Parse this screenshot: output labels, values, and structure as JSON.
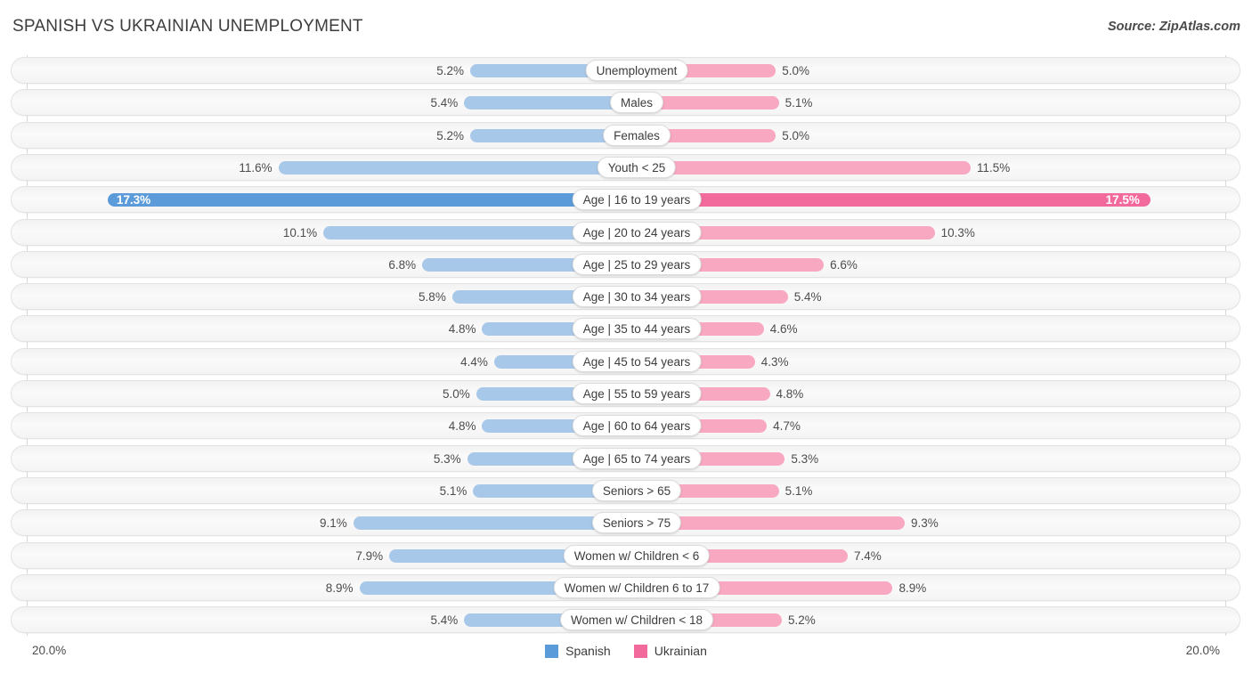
{
  "header": {
    "title": "SPANISH VS UKRAINIAN UNEMPLOYMENT",
    "source": "Source: ZipAtlas.com"
  },
  "legend": {
    "items": [
      {
        "label": "Spanish",
        "color": "#5b9bd9"
      },
      {
        "label": "Ukrainian",
        "color": "#f2699c"
      }
    ]
  },
  "axis": {
    "left_label": "20.0%",
    "right_label": "20.0%",
    "max": 20.0
  },
  "colors": {
    "left_bar": "#a8c8ea",
    "right_bar": "#f8a8c0",
    "left_bar_highlight": "#5b9bd9",
    "right_bar_highlight": "#f2699c",
    "track": "#f4f4f4",
    "text": "#3a3a3a"
  },
  "chart_data": {
    "type": "bar",
    "title": "SPANISH VS UKRAINIAN UNEMPLOYMENT",
    "subtitle": "",
    "xlabel": "",
    "ylabel": "",
    "orientation": "horizontal-diverging",
    "xlim": [
      0,
      20.0
    ],
    "grid": false,
    "legend_position": "bottom-center",
    "categories": [
      "Unemployment",
      "Males",
      "Females",
      "Youth < 25",
      "Age | 16 to 19 years",
      "Age | 20 to 24 years",
      "Age | 25 to 29 years",
      "Age | 30 to 34 years",
      "Age | 35 to 44 years",
      "Age | 45 to 54 years",
      "Age | 55 to 59 years",
      "Age | 60 to 64 years",
      "Age | 65 to 74 years",
      "Seniors > 65",
      "Seniors > 75",
      "Women w/ Children < 6",
      "Women w/ Children 6 to 17",
      "Women w/ Children < 18"
    ],
    "series": [
      {
        "name": "Spanish",
        "side": "left",
        "values": [
          5.2,
          5.4,
          5.2,
          11.6,
          17.3,
          10.1,
          6.8,
          5.8,
          4.8,
          4.4,
          5.0,
          4.8,
          5.3,
          5.1,
          9.1,
          7.9,
          8.9,
          5.4
        ],
        "labels": [
          "5.2%",
          "5.4%",
          "5.2%",
          "11.6%",
          "17.3%",
          "10.1%",
          "6.8%",
          "5.8%",
          "4.8%",
          "4.4%",
          "5.0%",
          "4.8%",
          "5.3%",
          "5.1%",
          "9.1%",
          "7.9%",
          "8.9%",
          "5.4%"
        ]
      },
      {
        "name": "Ukrainian",
        "side": "right",
        "values": [
          5.0,
          5.1,
          5.0,
          11.5,
          17.5,
          10.3,
          6.6,
          5.4,
          4.6,
          4.3,
          4.8,
          4.7,
          5.3,
          5.1,
          9.3,
          7.4,
          8.9,
          5.2
        ],
        "labels": [
          "5.0%",
          "5.1%",
          "5.0%",
          "11.5%",
          "17.5%",
          "10.3%",
          "6.6%",
          "5.4%",
          "4.6%",
          "4.3%",
          "4.8%",
          "4.7%",
          "5.3%",
          "5.1%",
          "9.3%",
          "7.4%",
          "8.9%",
          "5.2%"
        ]
      }
    ],
    "highlighted_row_index": 4
  }
}
